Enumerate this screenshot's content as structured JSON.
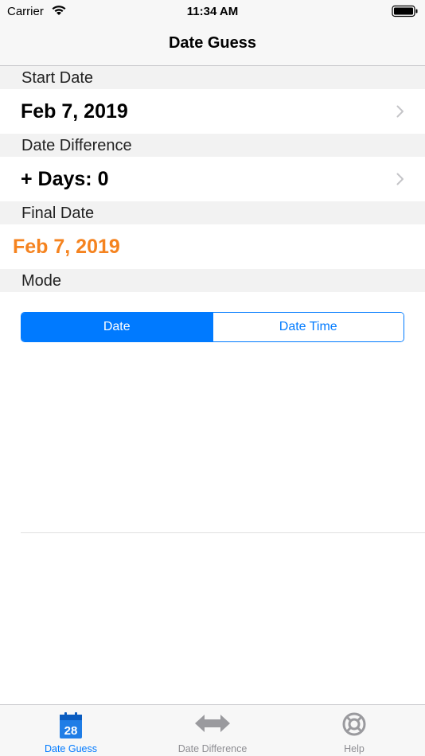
{
  "status_bar": {
    "carrier": "Carrier",
    "time": "11:34 AM"
  },
  "nav": {
    "title": "Date Guess"
  },
  "sections": {
    "start_date": {
      "header": "Start Date",
      "value": "Feb 7, 2019"
    },
    "date_difference": {
      "header": "Date Difference",
      "value": "+ Days: 0"
    },
    "final_date": {
      "header": "Final Date",
      "value": "Feb 7, 2019"
    },
    "mode": {
      "header": "Mode",
      "segments": [
        "Date",
        "Date Time"
      ],
      "selected": "Date"
    }
  },
  "tab_bar": {
    "items": [
      {
        "label": "Date Guess",
        "icon": "calendar-icon",
        "active": true,
        "badge": "28"
      },
      {
        "label": "Date Difference",
        "icon": "double-arrow-icon",
        "active": false
      },
      {
        "label": "Help",
        "icon": "lifebuoy-icon",
        "active": false
      }
    ]
  },
  "colors": {
    "accent": "#007aff",
    "final_date": "#f5831f",
    "inactive_tab": "#8e8e93"
  }
}
